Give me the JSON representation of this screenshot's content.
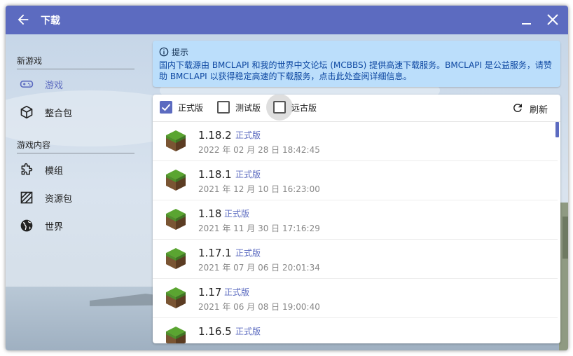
{
  "window": {
    "title": "下载"
  },
  "sidebar": {
    "sections": [
      {
        "title": "新游戏",
        "items": [
          {
            "label": "游戏",
            "icon": "gamepad-icon",
            "active": true
          },
          {
            "label": "整合包",
            "icon": "package-icon",
            "active": false
          }
        ]
      },
      {
        "title": "游戏内容",
        "items": [
          {
            "label": "模组",
            "icon": "puzzle-icon",
            "active": false
          },
          {
            "label": "资源包",
            "icon": "texture-icon",
            "active": false
          },
          {
            "label": "世界",
            "icon": "globe-icon",
            "active": false
          }
        ]
      }
    ]
  },
  "hint": {
    "title": "提示",
    "text": "国内下载源由 BMCLAPI 和我的世界中文论坛 (MCBBS) 提供高速下载服务。BMCLAPI 是公益服务，请赞助 BMCLAPI 以获得稳定高速的下载服务，点击此处查阅详细信息。"
  },
  "filters": [
    {
      "label": "正式版",
      "checked": true
    },
    {
      "label": "测试版",
      "checked": false
    },
    {
      "label": "远古版",
      "checked": false
    }
  ],
  "refresh_label": "刷新",
  "versions": [
    {
      "version": "1.18.2",
      "type": "正式版",
      "date": "2022 年 02 月 28 日 18:42:45"
    },
    {
      "version": "1.18.1",
      "type": "正式版",
      "date": "2021 年 12 月 10 日 16:23:00"
    },
    {
      "version": "1.18",
      "type": "正式版",
      "date": "2021 年 11 月 30 日 17:16:29"
    },
    {
      "version": "1.17.1",
      "type": "正式版",
      "date": "2021 年 07 月 06 日 20:01:34"
    },
    {
      "version": "1.17",
      "type": "正式版",
      "date": "2021 年 06 月 08 日 19:00:40"
    },
    {
      "version": "1.16.5",
      "type": "正式版",
      "date": ""
    }
  ],
  "colors": {
    "accent": "#5c6bc0",
    "hint_bg": "#bbdefb",
    "hint_text": "#0d47a1"
  }
}
